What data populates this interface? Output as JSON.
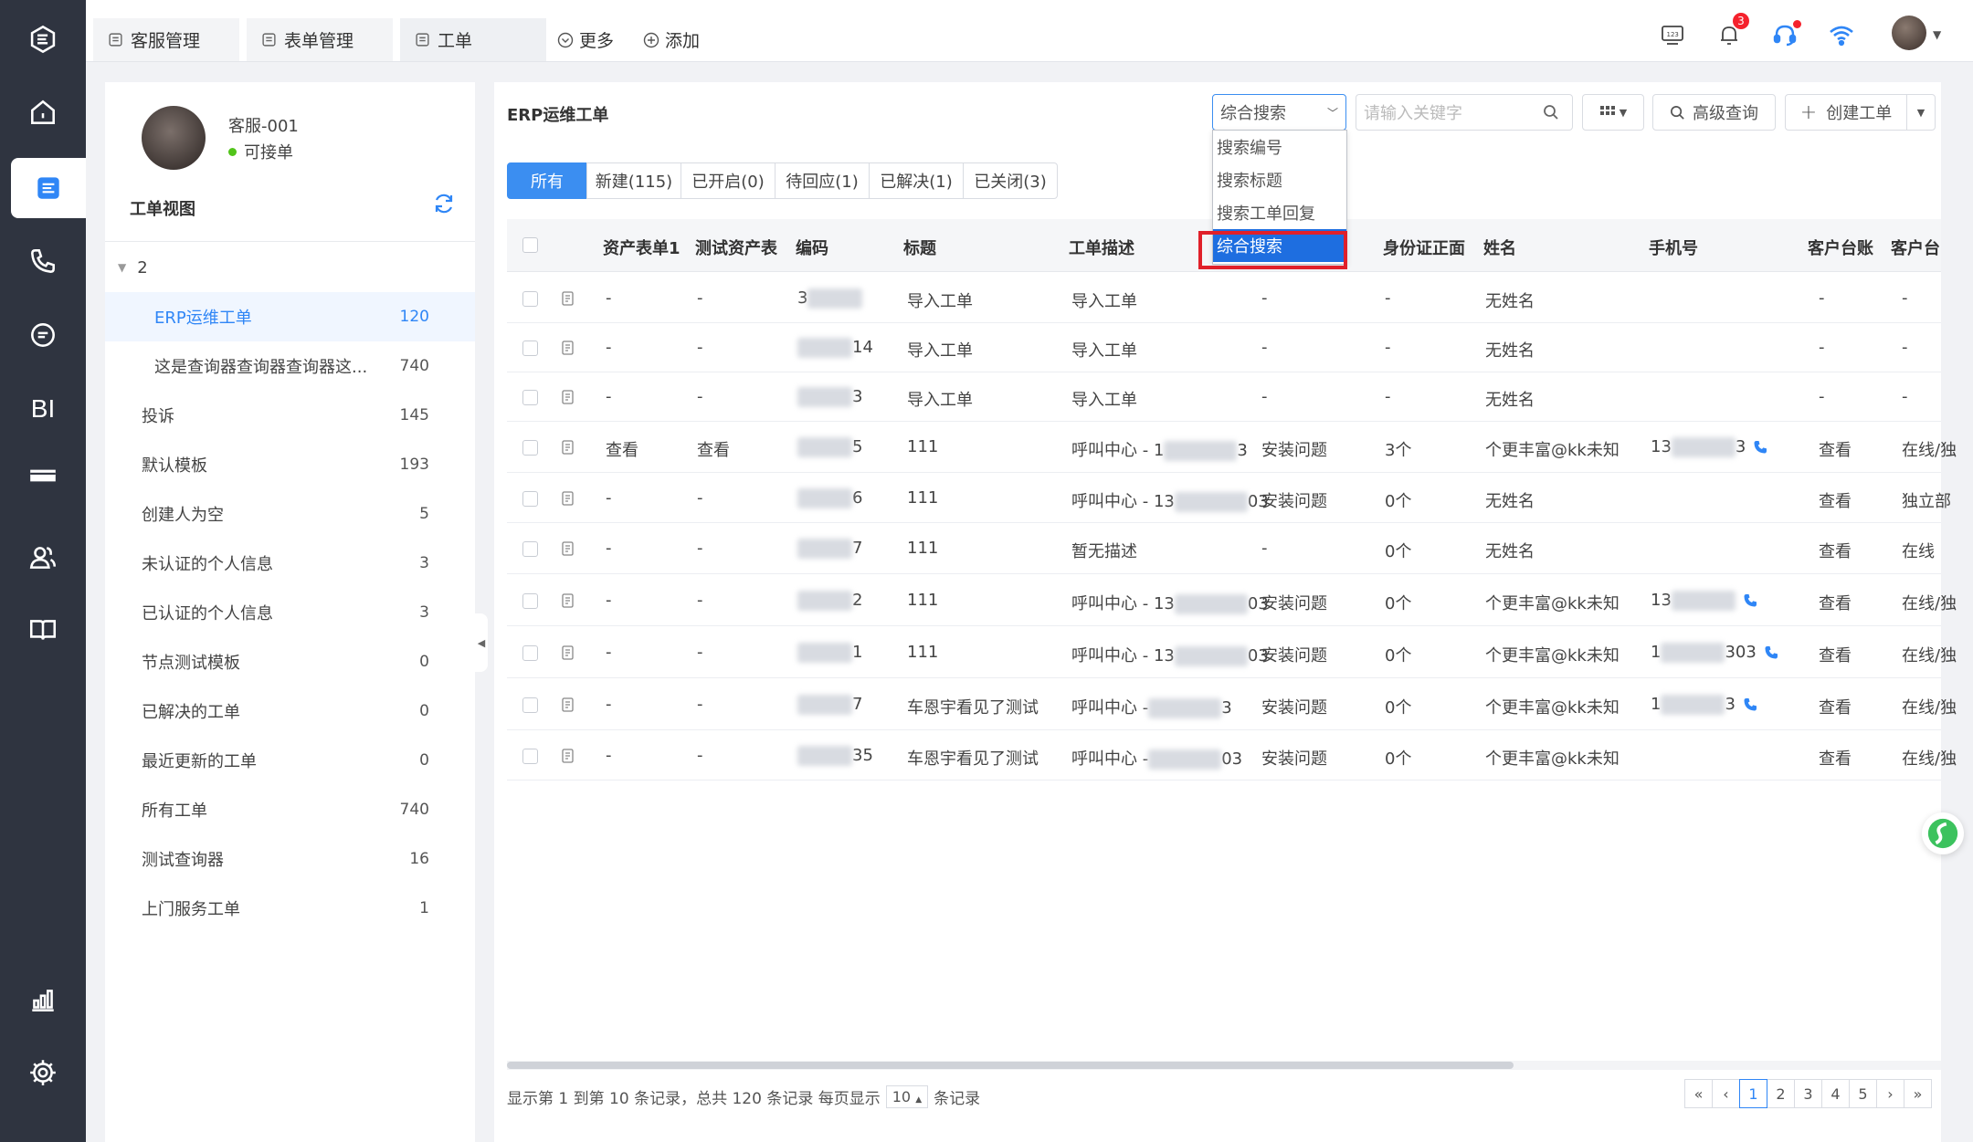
{
  "rail": {
    "bi_label": "BI"
  },
  "topbar": {
    "tabs": [
      "客服管理",
      "表单管理",
      "工单"
    ],
    "more_label": "更多",
    "add_label": "添加",
    "notification_count": "3"
  },
  "agent": {
    "name": "客服-001",
    "status": "可接单"
  },
  "ticket_view": {
    "title": "工单视图",
    "group_toggle": "2",
    "items": [
      {
        "label": "ERP运维工单",
        "count": "120"
      },
      {
        "label": "这是查询器查询器查询器这...",
        "count": "740"
      },
      {
        "label": "投诉",
        "count": "145"
      },
      {
        "label": "默认模板",
        "count": "193"
      },
      {
        "label": "创建人为空",
        "count": "5"
      },
      {
        "label": "未认证的个人信息",
        "count": "3"
      },
      {
        "label": "已认证的个人信息",
        "count": "3"
      },
      {
        "label": "节点测试模板",
        "count": "0"
      },
      {
        "label": "已解决的工单",
        "count": "0"
      },
      {
        "label": "最近更新的工单",
        "count": "0"
      },
      {
        "label": "所有工单",
        "count": "740"
      },
      {
        "label": "测试查询器",
        "count": "16"
      },
      {
        "label": "上门服务工单",
        "count": "1"
      }
    ]
  },
  "main": {
    "title": "ERP运维工单",
    "search_mode": "综合搜索",
    "search_placeholder": "请输入关键字",
    "advanced_label": "高级查询",
    "create_label": "创建工单",
    "dropdown_options": [
      "搜索编号",
      "搜索标题",
      "搜索工单回复",
      "综合搜索"
    ],
    "filter_tabs": [
      "所有",
      "新建(115)",
      "已开启(0)",
      "待回应(1)",
      "已解决(1)",
      "已关闭(3)"
    ],
    "columns": [
      "资产表单1",
      "测试资产表",
      "编码",
      "标题",
      "工单描述",
      "",
      "身份证正面",
      "姓名",
      "手机号",
      "客户台账",
      "客户台"
    ],
    "rows": [
      {
        "c1": "-",
        "c2": "-",
        "code": "3",
        "code_end": "",
        "title": "导入工单",
        "desc": "导入工单",
        "desc_end": "",
        "issue": "-",
        "idcard": "-",
        "name": "无姓名",
        "phone": "",
        "phone_end": "",
        "ledger": "-",
        "ledger2": "-"
      },
      {
        "c1": "-",
        "c2": "-",
        "code": "",
        "code_end": "14",
        "title": "导入工单",
        "desc": "导入工单",
        "desc_end": "",
        "issue": "-",
        "idcard": "-",
        "name": "无姓名",
        "phone": "",
        "phone_end": "",
        "ledger": "-",
        "ledger2": "-"
      },
      {
        "c1": "-",
        "c2": "-",
        "code": "",
        "code_end": "3",
        "title": "导入工单",
        "desc": "导入工单",
        "desc_end": "",
        "issue": "-",
        "idcard": "-",
        "name": "无姓名",
        "phone": "",
        "phone_end": "",
        "ledger": "-",
        "ledger2": "-"
      },
      {
        "c1": "查看",
        "c2": "查看",
        "code": "",
        "code_end": "5",
        "title": "111",
        "desc": "呼叫中心 - 1",
        "desc_end": "3",
        "issue": "安装问题",
        "idcard": "3个",
        "name": "个更丰富@kk未知",
        "phone": "13",
        "phone_end": "3",
        "ledger": "查看",
        "ledger2": "在线/独"
      },
      {
        "c1": "-",
        "c2": "-",
        "code": "",
        "code_end": "6",
        "title": "111",
        "desc": "呼叫中心 - 13",
        "desc_end": "03",
        "issue": "安装问题",
        "idcard": "0个",
        "name": "无姓名",
        "phone": "",
        "phone_end": "",
        "ledger": "查看",
        "ledger2": "独立部"
      },
      {
        "c1": "-",
        "c2": "-",
        "code": "",
        "code_end": "7",
        "title": "111",
        "desc": "暂无描述",
        "desc_end": "",
        "issue": "-",
        "idcard": "0个",
        "name": "无姓名",
        "phone": "",
        "phone_end": "",
        "ledger": "查看",
        "ledger2": "在线"
      },
      {
        "c1": "-",
        "c2": "-",
        "code": "",
        "code_end": "2",
        "title": "111",
        "desc": "呼叫中心 - 13",
        "desc_end": "03",
        "issue": "安装问题",
        "idcard": "0个",
        "name": "个更丰富@kk未知",
        "phone": "13",
        "phone_end": "",
        "ledger": "查看",
        "ledger2": "在线/独"
      },
      {
        "c1": "-",
        "c2": "-",
        "code": "",
        "code_end": "1",
        "title": "111",
        "desc": "呼叫中心 - 13",
        "desc_end": "03",
        "issue": "安装问题",
        "idcard": "0个",
        "name": "个更丰富@kk未知",
        "phone": "1",
        "phone_end": "303",
        "ledger": "查看",
        "ledger2": "在线/独"
      },
      {
        "c1": "-",
        "c2": "-",
        "code": "",
        "code_end": "7",
        "title": "车恩宇看见了测试",
        "desc": "呼叫中心 -",
        "desc_end": "3",
        "issue": "安装问题",
        "idcard": "0个",
        "name": "个更丰富@kk未知",
        "phone": "1",
        "phone_end": "3",
        "ledger": "查看",
        "ledger2": "在线/独"
      },
      {
        "c1": "-",
        "c2": "-",
        "code": "",
        "code_end": "35",
        "title": "车恩宇看见了测试",
        "desc": "呼叫中心 -",
        "desc_end": "03",
        "issue": "安装问题",
        "idcard": "0个",
        "name": "个更丰富@kk未知",
        "phone": "",
        "phone_end": "",
        "ledger": "查看",
        "ledger2": "在线/独"
      }
    ],
    "footer_text": "显示第 1 到第 10 条记录，总共 120 条记录 每页显示",
    "page_size": "10",
    "footer_suffix": "条记录",
    "pages": [
      "«",
      "‹",
      "1",
      "2",
      "3",
      "4",
      "5",
      "›",
      "»"
    ]
  },
  "colors": {
    "accent": "#2f86f6",
    "rail": "#2f3440",
    "highlight": "#e0202a"
  }
}
